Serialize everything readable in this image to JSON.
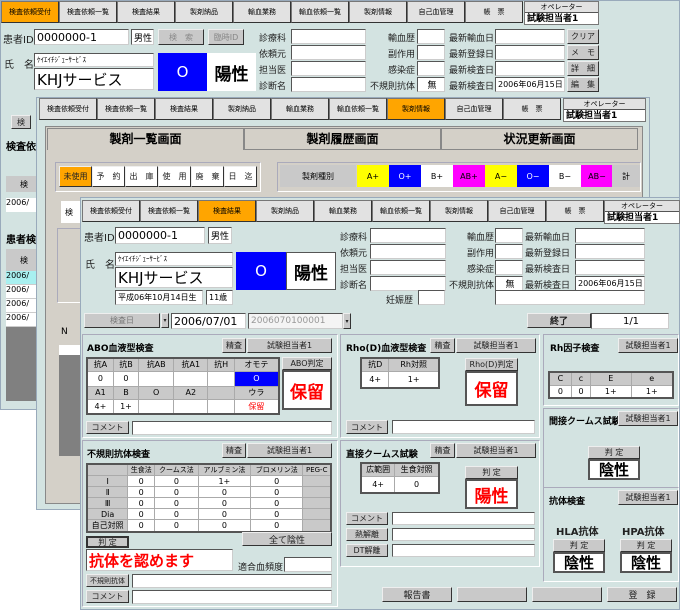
{
  "tabs": [
    "検査依頼受付",
    "検査依頼一覧",
    "検査結果",
    "製剤納品",
    "輸血業務",
    "輸血依頼一覧",
    "製剤情報",
    "自己血管理",
    "帳　票"
  ],
  "operator": {
    "label": "オペレーター",
    "value": "試験担当者1"
  },
  "colors": {
    "accent": "#ffa500",
    "background": "#d3e3e1",
    "button": "#c9c9c9",
    "blood_o": "#0000ff",
    "positive_text": "#ff0000"
  },
  "win1": {
    "active_tab": 0,
    "patient_id_label": "患者ID",
    "patient_id": "0000000-1",
    "sex": "男性",
    "search_button": "検　索",
    "temp_id_button": "臨時ID",
    "name_label": "氏　名",
    "kana": "ｹｲｴｲﾁｼﾞｪｰｻｰﾋﾞｽ",
    "name": "KHJサービス",
    "blood_type": "O",
    "rh": "陽性",
    "left_labels": [
      "診療科",
      "依頼元",
      "担当医",
      "診断名"
    ],
    "mid_labels": [
      "輸血歴",
      "副作用",
      "感染症",
      "不規則抗体"
    ],
    "mid_values": [
      "",
      "",
      "",
      "無"
    ],
    "right_labels": [
      "最新輸血日",
      "最新登録日",
      "最新検査日",
      "最新検査日"
    ],
    "right_values": [
      "",
      "",
      "",
      "2006年06月15日"
    ],
    "side_buttons": [
      "クリア",
      "メ　モ",
      "詳　細",
      "編　集"
    ],
    "partial": {
      "button": "検",
      "heading1": "検査依",
      "col1": "検",
      "row1": "2006/",
      "heading2": "患者検",
      "col2": "検",
      "rows": [
        "2006/",
        "2006/",
        "2006/",
        "2006/"
      ]
    }
  },
  "win2": {
    "active_tab": 6,
    "subtabs": [
      "製剤一覧画面",
      "製剤履歴画面",
      "状況更新画面"
    ],
    "status_buttons": [
      "未使用",
      "予　約",
      "出　庫",
      "使　用",
      "廃　棄",
      "日　迄"
    ],
    "active_status": 0,
    "product_type_label": "製剤種別",
    "blood_types": [
      {
        "label": "A+",
        "color": "#ffff00"
      },
      {
        "label": "O+",
        "color": "#0000ff"
      },
      {
        "label": "B+",
        "color": "#ffffff"
      },
      {
        "label": "AB+",
        "color": "#ff00ff"
      },
      {
        "label": "A−",
        "color": "#ffff00"
      },
      {
        "label": "O−",
        "color": "#0000ff"
      },
      {
        "label": "B−",
        "color": "#ffffff"
      },
      {
        "label": "AB−",
        "color": "#ff00ff"
      }
    ],
    "total_label": "計",
    "partial": {
      "tab": "検",
      "col": "N"
    }
  },
  "win3": {
    "active_tab": 2,
    "patient_id_label": "患者ID",
    "patient_id": "0000000-1",
    "sex": "男性",
    "name_label": "氏　名",
    "kana": "ｹｲｴｲﾁｼﾞｪｰｻｰﾋﾞｽ",
    "name": "KHJサービス",
    "dob": "平成06年10月14日生",
    "age": "11歳",
    "blood_type": "O",
    "rh": "陽性",
    "left_labels": [
      "診療科",
      "依頼元",
      "担当医",
      "診断名"
    ],
    "pregnancy_label": "妊娠歴",
    "mid_labels": [
      "輸血歴",
      "副作用",
      "感染症",
      "不規則抗体"
    ],
    "mid_values": [
      "",
      "",
      "",
      "無"
    ],
    "right_labels": [
      "最新輸血日",
      "最新登録日",
      "最新検査日",
      "最新検査日"
    ],
    "right_values": [
      "",
      "",
      "",
      "2006年06月15日"
    ],
    "toolbar": {
      "date_button": "検査日",
      "date": "2006/07/01",
      "test_id": "2006070100001",
      "end_button": "終了",
      "page": "1/1"
    },
    "abo": {
      "title": "ABO血液型検査",
      "detail_button": "精査",
      "tech_button": "試験担当者1",
      "front_headers": [
        "抗A",
        "抗B",
        "抗AB",
        "抗A1",
        "抗H",
        "オモテ"
      ],
      "front_values": [
        "0",
        "0",
        "",
        "",
        "",
        "O"
      ],
      "back_headers": [
        "A1",
        "B",
        "O",
        "A2",
        "",
        "ウラ"
      ],
      "back_values": [
        "4+",
        "1+",
        "",
        "",
        "",
        "保留"
      ],
      "judge_label": "ABO判定",
      "judge": "保留",
      "comment_button": "コメント",
      "comment": ""
    },
    "rhod": {
      "title": "Rho(D)血液型検査",
      "detail_button": "精査",
      "tech_button": "試験担当者1",
      "headers": [
        "抗D",
        "Rh対照"
      ],
      "values": [
        "4+",
        "1+"
      ],
      "judge_label": "Rho(D)判定",
      "judge": "保留",
      "comment_button": "コメント",
      "comment": ""
    },
    "rh_factor": {
      "title": "Rh因子検査",
      "tech_button": "試験担当者1",
      "headers": [
        "C",
        "c",
        "E",
        "e"
      ],
      "values": [
        "0",
        "0",
        "1+",
        "1+"
      ]
    },
    "indirect_coombs": {
      "title": "間接クームス試験",
      "tech_button": "試験担当者1",
      "judge_label": "判 定",
      "judge": "陰性"
    },
    "irregular": {
      "title": "不規則抗体検査",
      "detail_button": "精査",
      "tech_button": "試験担当者1",
      "headers": [
        "",
        "生食法",
        "クームス法",
        "アルブミン法",
        "ブロメリン法",
        "PEG-C"
      ],
      "rows": [
        {
          "label": "Ⅰ",
          "values": [
            "0",
            "0",
            "1+",
            "0"
          ]
        },
        {
          "label": "Ⅱ",
          "values": [
            "0",
            "0",
            "0",
            "0"
          ]
        },
        {
          "label": "Ⅲ",
          "values": [
            "0",
            "0",
            "0",
            "0"
          ]
        },
        {
          "label": "Dia",
          "values": [
            "0",
            "0",
            "0",
            "0"
          ]
        },
        {
          "label": "自己対照",
          "values": [
            "0",
            "0",
            "0",
            "0"
          ]
        }
      ],
      "judge_button": "判 定",
      "all_negative_button": "全て陰性",
      "result": "抗体を認めます",
      "compat_label": "適合血頻度",
      "compat": "",
      "antibody_button": "不規則抗体",
      "antibody": "",
      "comment_button": "コメント",
      "comment": ""
    },
    "direct_coombs": {
      "title": "直接クームス試験",
      "detail_button": "精査",
      "tech_button": "試験担当者1",
      "headers": [
        "広範囲",
        "生食対照"
      ],
      "values": [
        "4+",
        "0"
      ],
      "judge_label": "判 定",
      "judge": "陽性",
      "comment_button": "コメント",
      "heat_button": "熱解離",
      "dt_button": "DT解離"
    },
    "antibody": {
      "title": "抗体検査",
      "tech_button": "試験担当者1",
      "hla_label": "HLA抗体",
      "hpa_label": "HPA抗体",
      "judge_label": "判 定",
      "hla": "陰性",
      "hpa": "陰性"
    },
    "bottom_buttons": [
      "報告書",
      "",
      "",
      "登　録"
    ]
  }
}
